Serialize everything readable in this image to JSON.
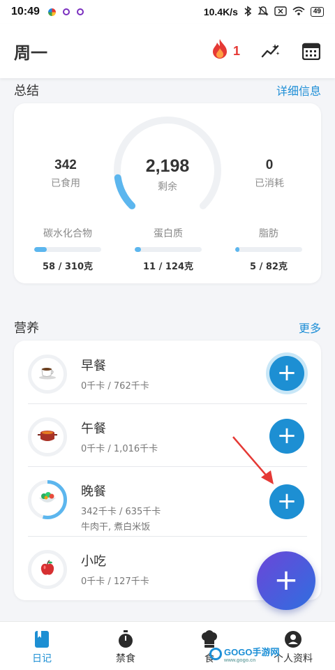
{
  "status_bar": {
    "time": "10:49",
    "network_speed": "10.4K/s",
    "battery": "49"
  },
  "header": {
    "day": "周一",
    "streak_count": "1",
    "icons": [
      "flame-icon",
      "trend-icon",
      "calendar-icon"
    ]
  },
  "summary": {
    "title": "总结",
    "details_link": "详细信息",
    "eaten_value": "342",
    "eaten_label": "已食用",
    "remaining_value": "2,198",
    "remaining_label": "剩余",
    "burned_value": "0",
    "burned_label": "已消耗",
    "gauge_fraction": 0.135,
    "macros": [
      {
        "label": "碳水化合物",
        "value": "58 / 310克",
        "fraction": 0.19
      },
      {
        "label": "蛋白质",
        "value": "11 / 124克",
        "fraction": 0.09
      },
      {
        "label": "脂肪",
        "value": "5 / 82克",
        "fraction": 0.06
      }
    ]
  },
  "nutrition": {
    "title": "营养",
    "more_link": "更多",
    "meals": [
      {
        "name": "早餐",
        "kcal": "0千卡 / 762千卡",
        "foods": "",
        "icon": "coffee-icon",
        "progress": 0
      },
      {
        "name": "午餐",
        "kcal": "0千卡 / 1,016千卡",
        "foods": "",
        "icon": "pot-icon",
        "progress": 0
      },
      {
        "name": "晚餐",
        "kcal": "342千卡 / 635千卡",
        "foods": "牛肉干, 煮白米饭",
        "icon": "salad-icon",
        "progress": 0.54
      },
      {
        "name": "小吃",
        "kcal": "0千卡 / 127千卡",
        "foods": "",
        "icon": "apple-icon",
        "progress": 0
      }
    ]
  },
  "bottom_nav": {
    "items": [
      {
        "label": "日记",
        "icon": "diary-icon",
        "active": true
      },
      {
        "label": "禁食",
        "icon": "stopwatch-icon",
        "active": false
      },
      {
        "label": "食",
        "icon": "chef-hat-icon",
        "active": false
      },
      {
        "label": "个人资料",
        "icon": "profile-icon",
        "active": false
      }
    ]
  },
  "watermark": {
    "text": "GOGO手游网",
    "sub": "www.gogo.cn"
  },
  "colors": {
    "accent": "#1d8fd3",
    "progress": "#5cb6ee",
    "streak": "#e53935"
  }
}
